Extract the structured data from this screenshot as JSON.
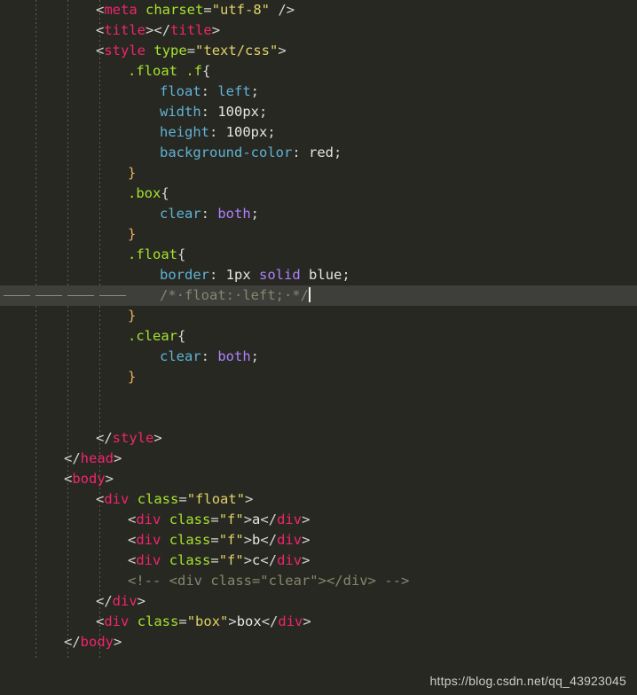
{
  "editor": {
    "theme_name": "monokai-dark",
    "background": "#282822",
    "active_line_background": "#3e3e3a",
    "font_size_px": 15.5,
    "line_height_px": 23,
    "active_line_index": 13,
    "cursor_visible": true,
    "indent_guide_columns": [
      40,
      76,
      112
    ],
    "colors": {
      "punctuation": "#d6d6d0",
      "tag": "#f0246e",
      "attribute": "#a6e22e",
      "string": "#e0d268",
      "selector": "#a6e22e",
      "property": "#5fb3d4",
      "value": "#e6e6e0",
      "keyword": "#ae81ff",
      "closing_brace": "#e8b060",
      "comment": "#86866f",
      "plain_text": "#e8e8e2"
    },
    "lines": [
      {
        "indent": 2,
        "tokens": [
          {
            "t": "<",
            "c": "punc"
          },
          {
            "t": "meta",
            "c": "tag"
          },
          {
            "t": " ",
            "c": "punc"
          },
          {
            "t": "charset",
            "c": "attr"
          },
          {
            "t": "=",
            "c": "punc"
          },
          {
            "t": "\"utf-8\"",
            "c": "str"
          },
          {
            "t": " ",
            "c": "punc"
          },
          {
            "t": "/>",
            "c": "punc"
          }
        ]
      },
      {
        "indent": 2,
        "tokens": [
          {
            "t": "<",
            "c": "punc"
          },
          {
            "t": "title",
            "c": "tag"
          },
          {
            "t": ">",
            "c": "punc"
          },
          {
            "t": "</",
            "c": "punc"
          },
          {
            "t": "title",
            "c": "tag"
          },
          {
            "t": ">",
            "c": "punc"
          }
        ]
      },
      {
        "indent": 2,
        "tokens": [
          {
            "t": "<",
            "c": "punc"
          },
          {
            "t": "style",
            "c": "tag"
          },
          {
            "t": " ",
            "c": "punc"
          },
          {
            "t": "type",
            "c": "attr"
          },
          {
            "t": "=",
            "c": "punc"
          },
          {
            "t": "\"text/css\"",
            "c": "str"
          },
          {
            "t": ">",
            "c": "punc"
          }
        ]
      },
      {
        "indent": 3,
        "tokens": [
          {
            "t": ".float .f",
            "c": "sel"
          },
          {
            "t": "{",
            "c": "punc"
          }
        ]
      },
      {
        "indent": 4,
        "tokens": [
          {
            "t": "float",
            "c": "prop"
          },
          {
            "t": ": ",
            "c": "punc"
          },
          {
            "t": "left",
            "c": "prop"
          },
          {
            "t": ";",
            "c": "punc"
          }
        ]
      },
      {
        "indent": 4,
        "tokens": [
          {
            "t": "width",
            "c": "prop"
          },
          {
            "t": ": ",
            "c": "punc"
          },
          {
            "t": "100px",
            "c": "val"
          },
          {
            "t": ";",
            "c": "punc"
          }
        ]
      },
      {
        "indent": 4,
        "tokens": [
          {
            "t": "height",
            "c": "prop"
          },
          {
            "t": ": ",
            "c": "punc"
          },
          {
            "t": "100px",
            "c": "val"
          },
          {
            "t": ";",
            "c": "punc"
          }
        ]
      },
      {
        "indent": 4,
        "tokens": [
          {
            "t": "background-color",
            "c": "prop"
          },
          {
            "t": ": ",
            "c": "punc"
          },
          {
            "t": "red",
            "c": "val"
          },
          {
            "t": ";",
            "c": "punc"
          }
        ]
      },
      {
        "indent": 3,
        "tokens": [
          {
            "t": "}",
            "c": "brace"
          }
        ]
      },
      {
        "indent": 3,
        "tokens": [
          {
            "t": ".box",
            "c": "sel"
          },
          {
            "t": "{",
            "c": "punc"
          }
        ]
      },
      {
        "indent": 4,
        "tokens": [
          {
            "t": "clear",
            "c": "prop"
          },
          {
            "t": ": ",
            "c": "punc"
          },
          {
            "t": "both",
            "c": "kw"
          },
          {
            "t": ";",
            "c": "punc"
          }
        ]
      },
      {
        "indent": 3,
        "tokens": [
          {
            "t": "}",
            "c": "brace"
          }
        ]
      },
      {
        "indent": 3,
        "tokens": [
          {
            "t": ".float",
            "c": "sel"
          },
          {
            "t": "{",
            "c": "punc"
          }
        ]
      },
      {
        "indent": 4,
        "tokens": [
          {
            "t": "border",
            "c": "prop"
          },
          {
            "t": ": ",
            "c": "punc"
          },
          {
            "t": "1px",
            "c": "val"
          },
          {
            "t": " ",
            "c": "punc"
          },
          {
            "t": "solid",
            "c": "kw"
          },
          {
            "t": " ",
            "c": "punc"
          },
          {
            "t": "blue",
            "c": "val"
          },
          {
            "t": ";",
            "c": "punc"
          }
        ]
      },
      {
        "indent": 4,
        "active": true,
        "cursor": true,
        "tokens": [
          {
            "t": "/*·float:·left;·*/",
            "c": "cmt"
          }
        ]
      },
      {
        "indent": 3,
        "tokens": [
          {
            "t": "}",
            "c": "brace"
          }
        ]
      },
      {
        "indent": 3,
        "tokens": [
          {
            "t": ".clear",
            "c": "sel"
          },
          {
            "t": "{",
            "c": "punc"
          }
        ]
      },
      {
        "indent": 4,
        "tokens": [
          {
            "t": "clear",
            "c": "prop"
          },
          {
            "t": ": ",
            "c": "punc"
          },
          {
            "t": "both",
            "c": "kw"
          },
          {
            "t": ";",
            "c": "punc"
          }
        ]
      },
      {
        "indent": 3,
        "tokens": [
          {
            "t": "}",
            "c": "brace"
          }
        ]
      },
      {
        "indent": 0,
        "tokens": []
      },
      {
        "indent": 0,
        "tokens": []
      },
      {
        "indent": 2,
        "tokens": [
          {
            "t": "</",
            "c": "punc"
          },
          {
            "t": "style",
            "c": "tag"
          },
          {
            "t": ">",
            "c": "punc"
          }
        ]
      },
      {
        "indent": 1,
        "tokens": [
          {
            "t": "</",
            "c": "punc"
          },
          {
            "t": "head",
            "c": "tag"
          },
          {
            "t": ">",
            "c": "punc"
          }
        ]
      },
      {
        "indent": 1,
        "tokens": [
          {
            "t": "<",
            "c": "punc"
          },
          {
            "t": "body",
            "c": "tag"
          },
          {
            "t": ">",
            "c": "punc"
          }
        ]
      },
      {
        "indent": 2,
        "tokens": [
          {
            "t": "<",
            "c": "punc"
          },
          {
            "t": "div",
            "c": "tag"
          },
          {
            "t": " ",
            "c": "punc"
          },
          {
            "t": "class",
            "c": "attr"
          },
          {
            "t": "=",
            "c": "punc"
          },
          {
            "t": "\"float\"",
            "c": "str"
          },
          {
            "t": ">",
            "c": "punc"
          }
        ]
      },
      {
        "indent": 3,
        "tokens": [
          {
            "t": "<",
            "c": "punc"
          },
          {
            "t": "div",
            "c": "tag"
          },
          {
            "t": " ",
            "c": "punc"
          },
          {
            "t": "class",
            "c": "attr"
          },
          {
            "t": "=",
            "c": "punc"
          },
          {
            "t": "\"f\"",
            "c": "str"
          },
          {
            "t": ">",
            "c": "punc"
          },
          {
            "t": "a",
            "c": "text"
          },
          {
            "t": "</",
            "c": "punc"
          },
          {
            "t": "div",
            "c": "tag"
          },
          {
            "t": ">",
            "c": "punc"
          }
        ]
      },
      {
        "indent": 3,
        "tokens": [
          {
            "t": "<",
            "c": "punc"
          },
          {
            "t": "div",
            "c": "tag"
          },
          {
            "t": " ",
            "c": "punc"
          },
          {
            "t": "class",
            "c": "attr"
          },
          {
            "t": "=",
            "c": "punc"
          },
          {
            "t": "\"f\"",
            "c": "str"
          },
          {
            "t": ">",
            "c": "punc"
          },
          {
            "t": "b",
            "c": "text"
          },
          {
            "t": "</",
            "c": "punc"
          },
          {
            "t": "div",
            "c": "tag"
          },
          {
            "t": ">",
            "c": "punc"
          }
        ]
      },
      {
        "indent": 3,
        "tokens": [
          {
            "t": "<",
            "c": "punc"
          },
          {
            "t": "div",
            "c": "tag"
          },
          {
            "t": " ",
            "c": "punc"
          },
          {
            "t": "class",
            "c": "attr"
          },
          {
            "t": "=",
            "c": "punc"
          },
          {
            "t": "\"f\"",
            "c": "str"
          },
          {
            "t": ">",
            "c": "punc"
          },
          {
            "t": "c",
            "c": "text"
          },
          {
            "t": "</",
            "c": "punc"
          },
          {
            "t": "div",
            "c": "tag"
          },
          {
            "t": ">",
            "c": "punc"
          }
        ]
      },
      {
        "indent": 3,
        "tokens": [
          {
            "t": "<!-- <div class=\"clear\"></div> -->",
            "c": "cmt"
          }
        ]
      },
      {
        "indent": 2,
        "tokens": [
          {
            "t": "</",
            "c": "punc"
          },
          {
            "t": "div",
            "c": "tag"
          },
          {
            "t": ">",
            "c": "punc"
          }
        ]
      },
      {
        "indent": 2,
        "tokens": [
          {
            "t": "<",
            "c": "punc"
          },
          {
            "t": "div",
            "c": "tag"
          },
          {
            "t": " ",
            "c": "punc"
          },
          {
            "t": "class",
            "c": "attr"
          },
          {
            "t": "=",
            "c": "punc"
          },
          {
            "t": "\"box\"",
            "c": "str"
          },
          {
            "t": ">",
            "c": "punc"
          },
          {
            "t": "box",
            "c": "text"
          },
          {
            "t": "</",
            "c": "punc"
          },
          {
            "t": "div",
            "c": "tag"
          },
          {
            "t": ">",
            "c": "punc"
          }
        ]
      },
      {
        "indent": 1,
        "tokens": [
          {
            "t": "</",
            "c": "punc"
          },
          {
            "t": "body",
            "c": "tag"
          },
          {
            "t": ">",
            "c": "punc"
          }
        ]
      }
    ]
  },
  "watermark": {
    "url": "https://blog.csdn.net/qq_43923045"
  }
}
